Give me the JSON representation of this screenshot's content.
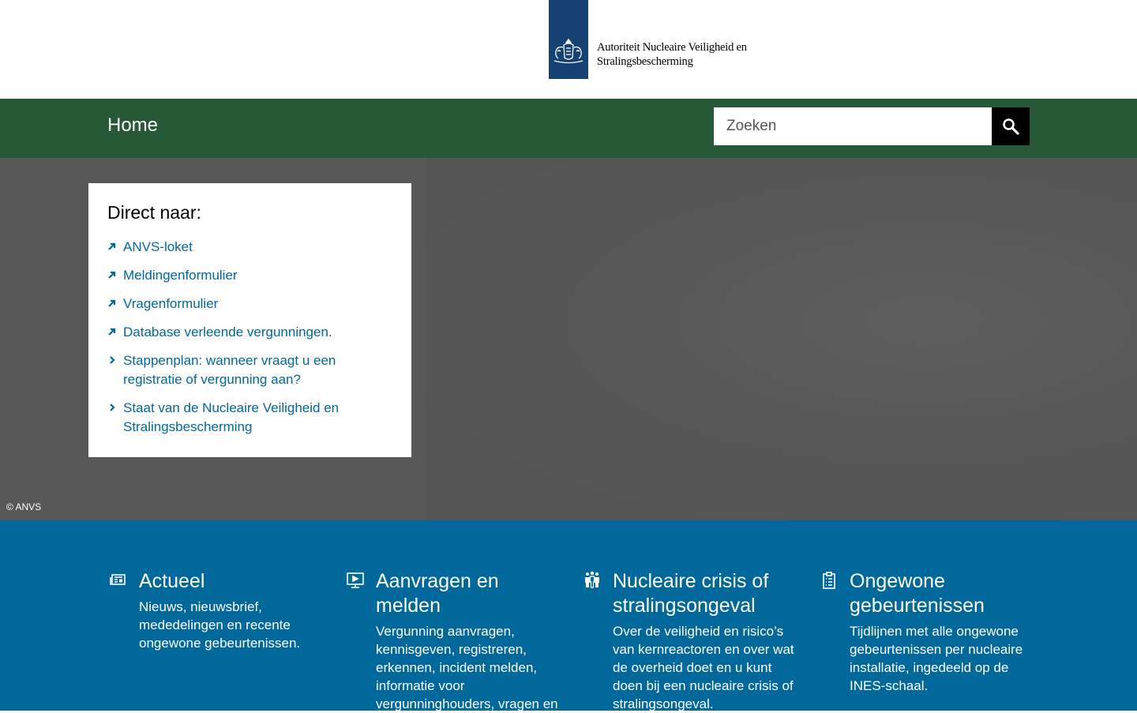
{
  "header": {
    "logo_line1": "Autoriteit Nucleaire Veiligheid en",
    "logo_line2": "Stralingsbescherming"
  },
  "nav": {
    "home_label": "Home",
    "search_placeholder": "Zoeken"
  },
  "direct": {
    "title": "Direct naar:",
    "items": [
      {
        "label": "ANVS-loket",
        "icon": "external-arrow-icon"
      },
      {
        "label": "Meldingenformulier",
        "icon": "external-arrow-icon"
      },
      {
        "label": "Vragenformulier",
        "icon": "external-arrow-icon"
      },
      {
        "label": "Database verleende vergunningen.",
        "icon": "external-arrow-icon"
      },
      {
        "label": "Stappenplan: wanneer vraagt u een registratie of vergunning aan?",
        "icon": "chevron-right-icon"
      },
      {
        "label": "Staat van de Nucleaire Veiligheid en Stralingsbescherming",
        "icon": "chevron-right-icon"
      }
    ]
  },
  "hero": {
    "copyright": "© ANVS"
  },
  "tiles": [
    {
      "title": "Actueel",
      "text": "Nieuws, nieuwsbrief, mededelingen en recente ongewone gebeurtenissen.",
      "icon": "newspaper-icon"
    },
    {
      "title": "Aanvragen en melden",
      "text": "Vergunning aanvragen, kennisgeven, registreren, erkennen, incident melden, informatie voor vergunninghouders, vragen en",
      "icon": "monitor-icon"
    },
    {
      "title": "Nucleaire crisis of stralingsongeval",
      "text": "Over de veiligheid en risico’s van kernreactoren en over wat de overheid doet en u kunt doen bij een nucleaire crisis of stralingsongeval.",
      "icon": "people-icon"
    },
    {
      "title": "Ongewone gebeurtenissen",
      "text": "Tijdlijnen met alle ongewone gebeurtenissen per nucleaire installatie, ingedeeld op de INES-schaal.",
      "icon": "clipboard-icon"
    }
  ],
  "colors": {
    "header_blue": "#154273",
    "nav_green": "#275937",
    "link_blue": "#01689b",
    "section_blue": "#01689b"
  }
}
